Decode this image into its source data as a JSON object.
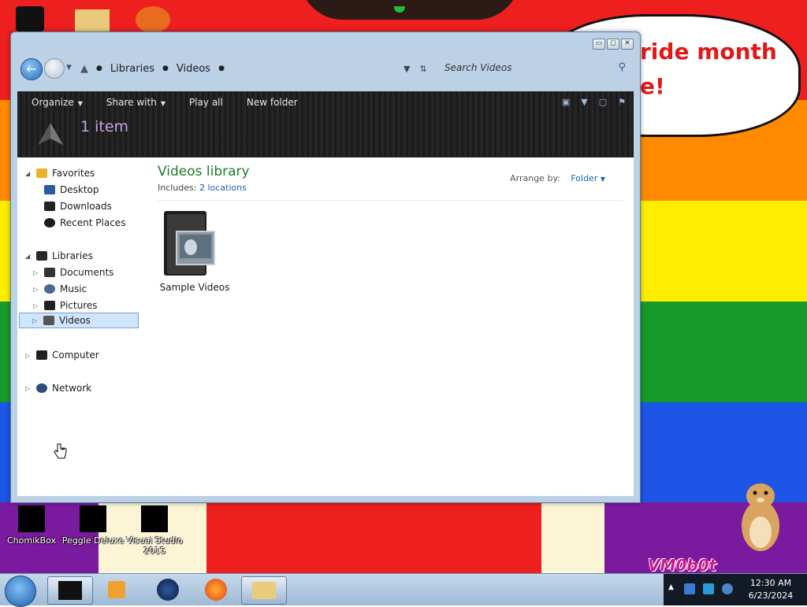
{
  "desktop": {
    "bubble_line1": "ride month",
    "bubble_line2": "e!",
    "icons": [
      {
        "label": "ChomikBox"
      },
      {
        "label": "Peggle Deluxe"
      },
      {
        "label": "Visual Studio 2015"
      }
    ],
    "watermark": "VM0b0t"
  },
  "window": {
    "controls": {
      "minimize": "▭",
      "maximize": "◻",
      "close": "✕"
    },
    "address": {
      "crumbs": [
        "Libraries",
        "Videos"
      ]
    },
    "search": {
      "placeholder": "Search Videos"
    },
    "toolbar": {
      "organize": "Organize",
      "share_with": "Share with",
      "play_all": "Play all",
      "new_folder": "New folder"
    },
    "item_count": "1 item",
    "nav": {
      "favorites": {
        "label": "Favorites",
        "items": [
          "Desktop",
          "Downloads",
          "Recent Places"
        ]
      },
      "libraries": {
        "label": "Libraries",
        "items": [
          "Documents",
          "Music",
          "Pictures",
          "Videos"
        ]
      },
      "computer": "Computer",
      "network": "Network",
      "selected": "Videos"
    },
    "content": {
      "title": "Videos library",
      "includes_label": "Includes:",
      "includes_link": "2 locations",
      "arrange_label": "Arrange by:",
      "arrange_value": "Folder",
      "items": [
        {
          "label": "Sample Videos"
        }
      ]
    }
  },
  "taskbar": {
    "time": "12:30 AM",
    "date": "6/23/2024"
  },
  "colors": {
    "title_green": "#1e7c2a",
    "link_blue": "#1a5fb4",
    "count_purple": "#c9a4e6"
  }
}
